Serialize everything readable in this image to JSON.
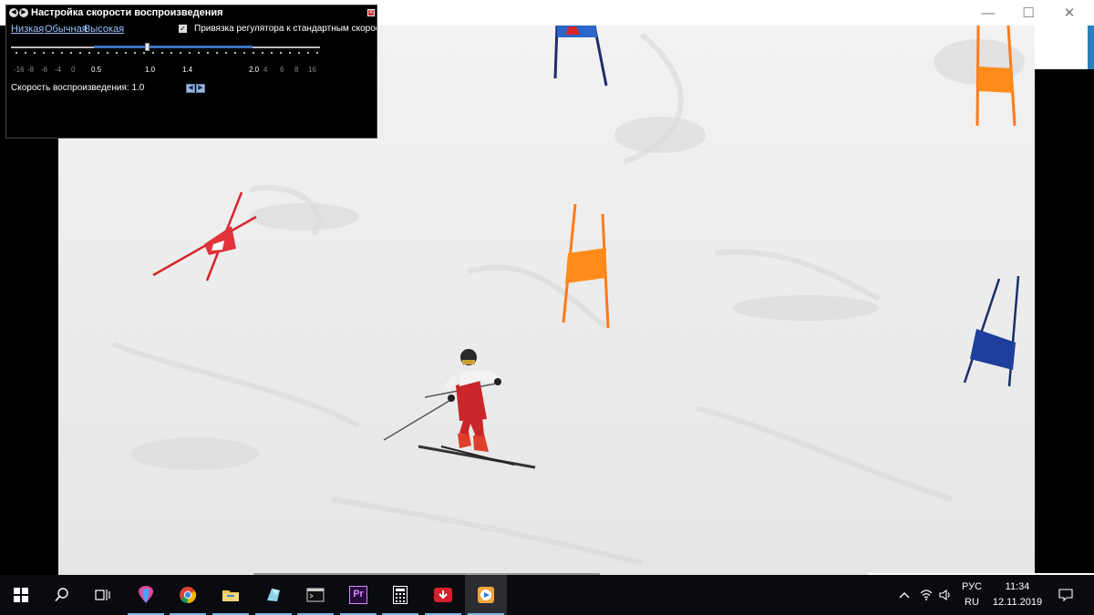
{
  "window": {
    "controls": {
      "minimize": "—",
      "maximize": "☐",
      "close": "✕"
    }
  },
  "speed_dialog": {
    "title": "Настройка скорости воспроизведения",
    "presets": {
      "low": "Низкая",
      "normal": "Обычная",
      "high": "Высокая"
    },
    "snap_checkbox": {
      "checked": true,
      "label": "Привязка регулятора к стандартным скорос"
    },
    "scale_labels": [
      "-16",
      "-8",
      "-6",
      "-4",
      "0",
      "0.5",
      "1.0",
      "1.4",
      "2.0",
      "4",
      "6",
      "8",
      "16"
    ],
    "active_labels": [
      "0.5",
      "1.0",
      "1.4",
      "2.0"
    ],
    "slider": {
      "value": 1.0,
      "range_min": 0.5,
      "range_max": 2.0
    },
    "readout": "Скорость воспроизведения: 1.0",
    "step_buttons": {
      "prev": "◀",
      "next": "▶"
    }
  },
  "video": {
    "content": "ski-gate-slalom-frame",
    "colors": {
      "snow": "#ececec",
      "gate_orange": "#ff8c1a",
      "gate_blue": "#1e3f9c",
      "gate_red": "#d8242b",
      "racer_suit": "#c8262b"
    }
  },
  "taskbar": {
    "apps": [
      {
        "name": "start-icon"
      },
      {
        "name": "search-icon"
      },
      {
        "name": "task-view-icon"
      },
      {
        "name": "paint3d-icon"
      },
      {
        "name": "chrome-icon"
      },
      {
        "name": "explorer-icon"
      },
      {
        "name": "crystal-icon"
      },
      {
        "name": "terminal-icon"
      },
      {
        "name": "premiere-icon",
        "label": "Pr"
      },
      {
        "name": "calculator-icon"
      },
      {
        "name": "download-icon"
      },
      {
        "name": "media-player-icon",
        "active": true
      }
    ],
    "tray": {
      "language_top": "РУС",
      "language_bottom": "RU",
      "time": "11:34",
      "date": "12.11.2019"
    }
  }
}
